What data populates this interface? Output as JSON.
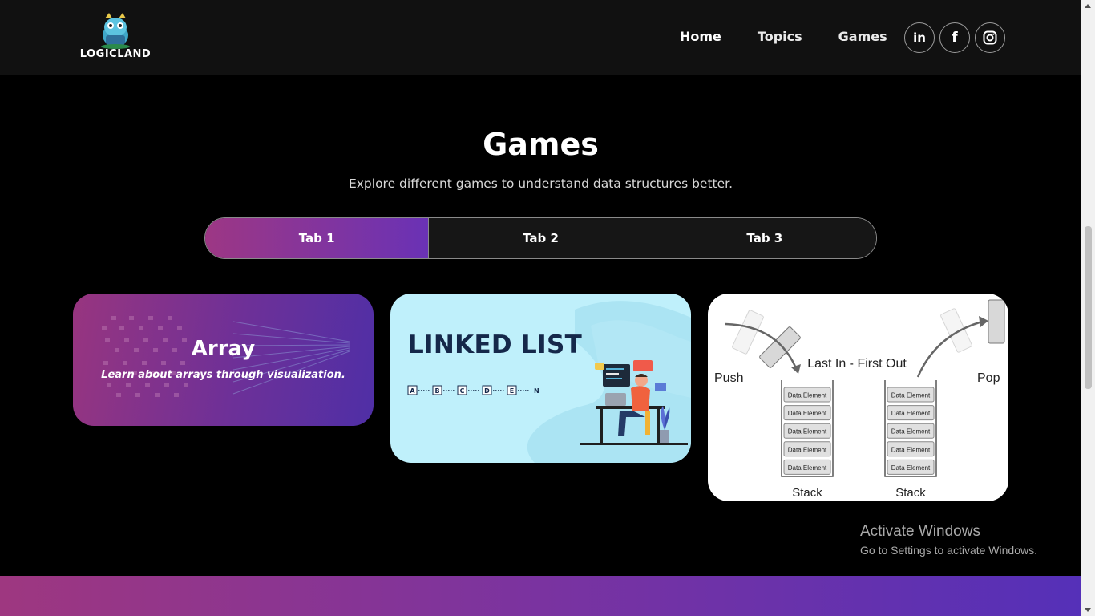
{
  "nav": {
    "logo_text": "LOGICLAND",
    "links": [
      {
        "label": "Home"
      },
      {
        "label": "Topics"
      },
      {
        "label": "Games"
      }
    ],
    "socials": [
      {
        "icon": "linkedin-icon",
        "glyph": "in"
      },
      {
        "icon": "facebook-icon",
        "glyph": "f"
      },
      {
        "icon": "instagram-icon",
        "glyph": ""
      }
    ]
  },
  "section": {
    "title": "Games",
    "subtitle": "Explore different games to understand data structures better."
  },
  "tabs": [
    {
      "label": "Tab 1",
      "active": true
    },
    {
      "label": "Tab 2",
      "active": false
    },
    {
      "label": "Tab 3",
      "active": false
    }
  ],
  "cards": {
    "array": {
      "title": "Array",
      "description": "Learn about arrays through visualization."
    },
    "linked_list": {
      "title": "LINKED LIST",
      "nodes": [
        "A",
        "B",
        "C",
        "D",
        "E",
        "N"
      ]
    },
    "stack": {
      "caption": "Last In - First Out",
      "push_label": "Push",
      "pop_label": "Pop",
      "element_label": "Data Element",
      "stack_label": "Stack"
    }
  },
  "watermark": {
    "line1": "Activate Windows",
    "line2": "Go to Settings to activate Windows."
  },
  "colors": {
    "accent_start": "#9d3784",
    "accent_end": "#6a32b5",
    "linked_list_bg": "#bff0fb"
  }
}
